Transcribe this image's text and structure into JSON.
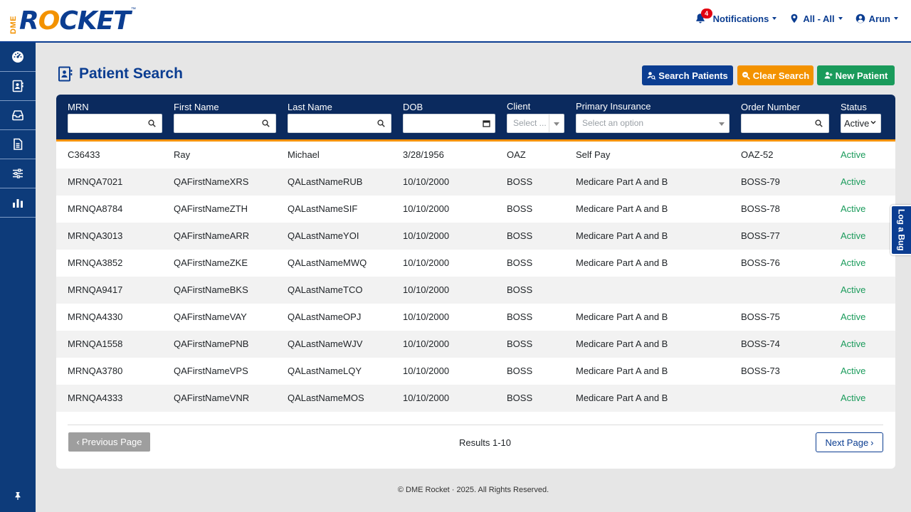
{
  "brand": {
    "prefix": "DME",
    "name_r": "R",
    "name_o": "O",
    "name_rest": "CKET",
    "tm": "™"
  },
  "nav": {
    "notifications_label": "Notifications",
    "notifications_count": "4",
    "location_label": "All - All",
    "user_label": "Arun"
  },
  "sidebar": {
    "items": [
      "dashboard-icon",
      "patient-card-icon",
      "inbox-icon",
      "document-icon",
      "sliders-icon",
      "bar-chart-icon"
    ],
    "pin": "pin-icon"
  },
  "page": {
    "title": "Patient Search",
    "buttons": {
      "search": "Search Patients",
      "clear": "Clear Search",
      "new_patient": "New Patient"
    }
  },
  "filters": {
    "mrn": "MRN",
    "first_name": "First Name",
    "last_name": "Last Name",
    "dob": "DOB",
    "client": "Client",
    "client_placeholder": "Select ...",
    "primary_insurance": "Primary Insurance",
    "insurance_placeholder": "Select an option",
    "order_number": "Order Number",
    "status": "Status",
    "status_value": "Active"
  },
  "patients": [
    {
      "mrn": "C36433",
      "first": "Ray",
      "last": "Michael",
      "dob": "3/28/1956",
      "client": "OAZ",
      "insurance": "Self Pay",
      "order": "OAZ-52",
      "status": "Active"
    },
    {
      "mrn": "MRNQA7021",
      "first": "QAFirstNameXRS",
      "last": "QALastNameRUB",
      "dob": "10/10/2000",
      "client": "BOSS",
      "insurance": "Medicare Part A and B",
      "order": "BOSS-79",
      "status": "Active"
    },
    {
      "mrn": "MRNQA8784",
      "first": "QAFirstNameZTH",
      "last": "QALastNameSIF",
      "dob": "10/10/2000",
      "client": "BOSS",
      "insurance": "Medicare Part A and B",
      "order": "BOSS-78",
      "status": "Active"
    },
    {
      "mrn": "MRNQA3013",
      "first": "QAFirstNameARR",
      "last": "QALastNameYOI",
      "dob": "10/10/2000",
      "client": "BOSS",
      "insurance": "Medicare Part A and B",
      "order": "BOSS-77",
      "status": "Active"
    },
    {
      "mrn": "MRNQA3852",
      "first": "QAFirstNameZKE",
      "last": "QALastNameMWQ",
      "dob": "10/10/2000",
      "client": "BOSS",
      "insurance": "Medicare Part A and B",
      "order": "BOSS-76",
      "status": "Active"
    },
    {
      "mrn": "MRNQA9417",
      "first": "QAFirstNameBKS",
      "last": "QALastNameTCO",
      "dob": "10/10/2000",
      "client": "BOSS",
      "insurance": "",
      "order": "",
      "status": "Active"
    },
    {
      "mrn": "MRNQA4330",
      "first": "QAFirstNameVAY",
      "last": "QALastNameOPJ",
      "dob": "10/10/2000",
      "client": "BOSS",
      "insurance": "Medicare Part A and B",
      "order": "BOSS-75",
      "status": "Active"
    },
    {
      "mrn": "MRNQA1558",
      "first": "QAFirstNamePNB",
      "last": "QALastNameWJV",
      "dob": "10/10/2000",
      "client": "BOSS",
      "insurance": "Medicare Part A and B",
      "order": "BOSS-74",
      "status": "Active"
    },
    {
      "mrn": "MRNQA3780",
      "first": "QAFirstNameVPS",
      "last": "QALastNameLQY",
      "dob": "10/10/2000",
      "client": "BOSS",
      "insurance": "Medicare Part A and B",
      "order": "BOSS-73",
      "status": "Active"
    },
    {
      "mrn": "MRNQA4333",
      "first": "QAFirstNameVNR",
      "last": "QALastNameMOS",
      "dob": "10/10/2000",
      "client": "BOSS",
      "insurance": "Medicare Part A and B",
      "order": "",
      "status": "Active"
    }
  ],
  "pagination": {
    "prev": "Previous Page",
    "next": "Next Page",
    "results": "Results 1-10"
  },
  "footer": "© DME Rocket  ·  2025. All Rights Reserved.",
  "log_bug": "Log a Bug",
  "colors": {
    "brand_blue": "#0b3d91",
    "brand_orange": "#f39200",
    "success_green": "#1a9b5b"
  }
}
